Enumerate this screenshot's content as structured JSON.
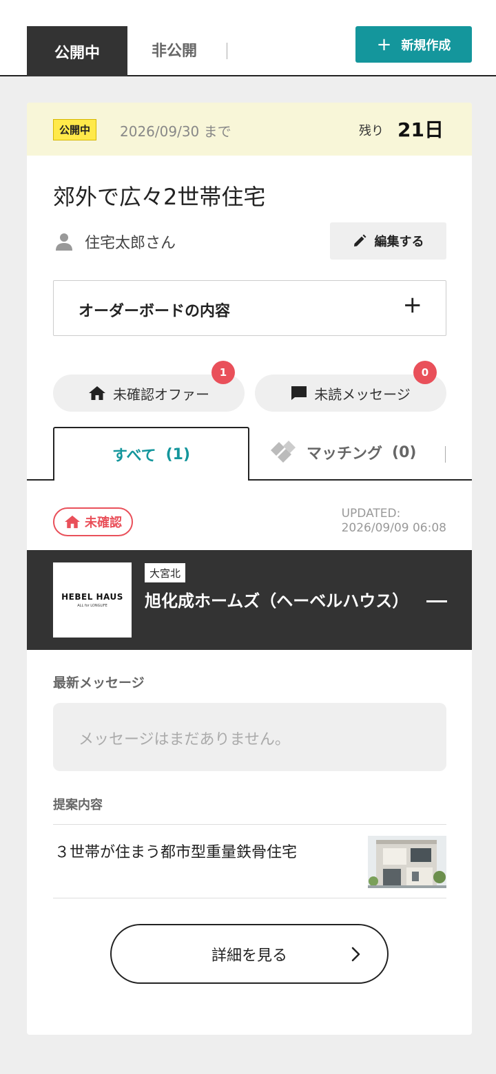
{
  "header": {
    "tab_public": "公開中",
    "tab_private": "非公開",
    "new_button_label": "新規作成"
  },
  "card": {
    "status_badge": "公開中",
    "until": "2026/09/30 まで",
    "remaining_label": "残り",
    "remaining_value": "21日",
    "title": "郊外で広々2世帯住宅",
    "user_name": "住宅太郎さん",
    "edit_label": "編集する",
    "order_board_label": "オーダーボードの内容",
    "unconfirmed_offers": {
      "label": "未確認オファー",
      "count": "1"
    },
    "unread_messages": {
      "label": "未読メッセージ",
      "count": "0"
    },
    "tabs": {
      "all": "すべて",
      "all_count": "(1)",
      "matching": "マッチング",
      "matching_count": "(0)"
    },
    "offer": {
      "status": "未確認",
      "updated_label": "UPDATED:",
      "updated_value": "2026/09/09 06:08",
      "logo_main": "HEBEL HAUS",
      "logo_sub": "ALL for LONGLIFE",
      "area": "大宮北",
      "company": "旭化成ホームズ（ヘーベルハウス）",
      "latest_message_label": "最新メッセージ",
      "latest_message": "メッセージはまだありません。",
      "proposal_label": "提案内容",
      "proposal_title": "３世帯が住まう都市型重量鉄骨住宅",
      "detail_button": "詳細を見る"
    }
  },
  "colors": {
    "accent": "#14969c",
    "alert": "#e9505a",
    "dark": "#333333",
    "status_bg": "#f8f6d8",
    "badge": "#ffe94a"
  }
}
